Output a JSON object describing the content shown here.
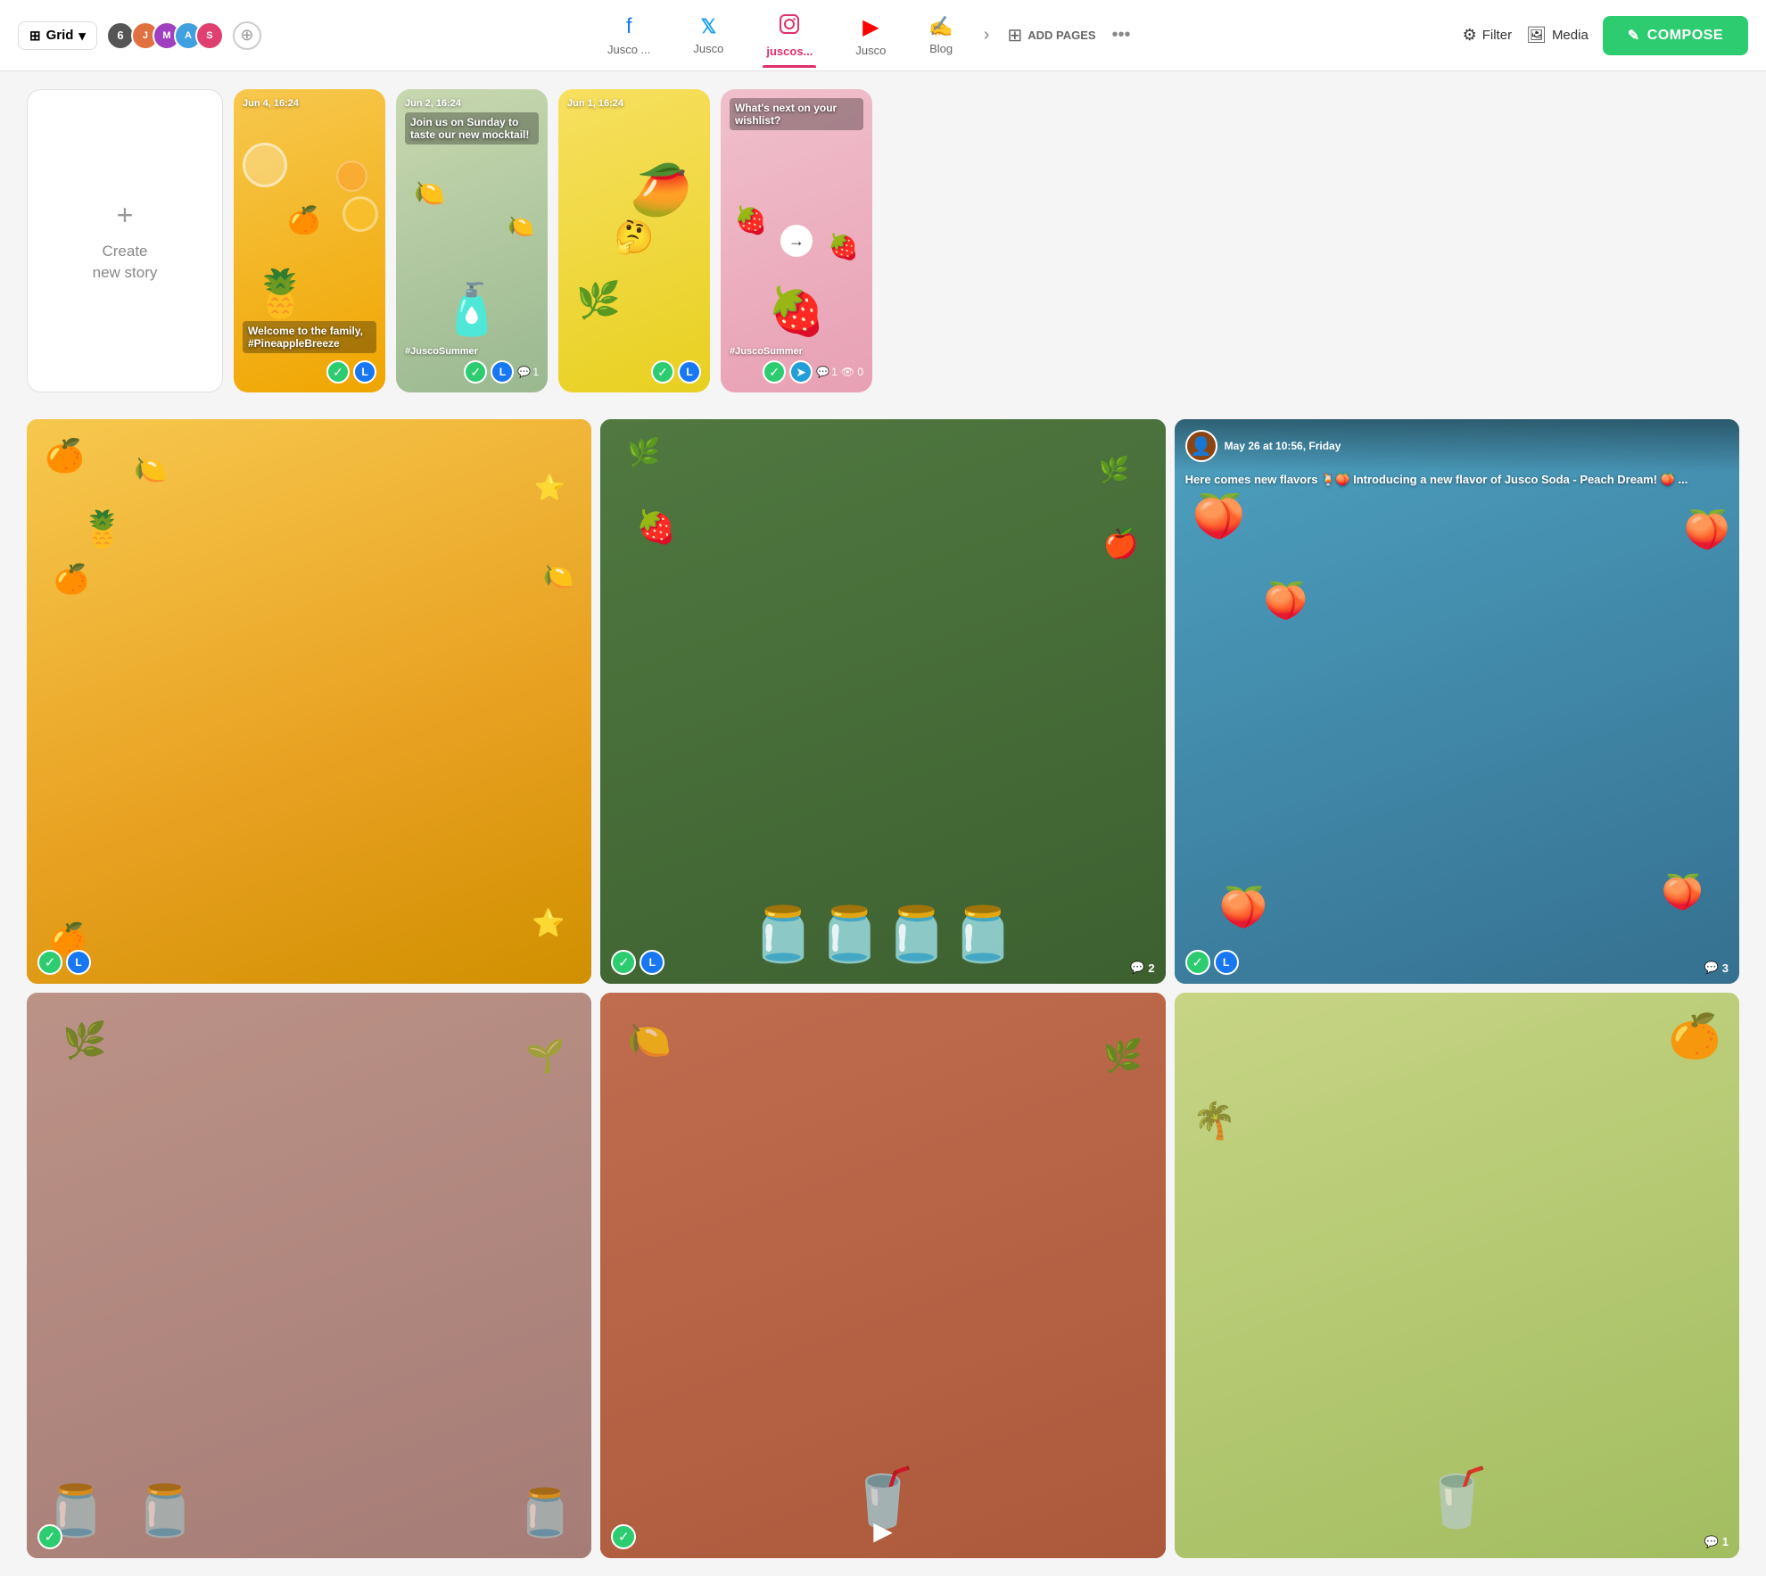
{
  "topnav": {
    "grid_label": "Grid",
    "avatar_count": "6",
    "tabs": [
      {
        "id": "facebook",
        "label": "Jusco ...",
        "icon": "f",
        "active": false,
        "color": "#1877f2"
      },
      {
        "id": "twitter",
        "label": "Jusco",
        "icon": "𝕏",
        "active": false,
        "color": "#1da1f2"
      },
      {
        "id": "instagram",
        "label": "juscos...",
        "icon": "📸",
        "active": true,
        "color": "#e1306c"
      },
      {
        "id": "youtube",
        "label": "Jusco",
        "icon": "▶",
        "active": false,
        "color": "#ff0000"
      },
      {
        "id": "blog",
        "label": "Blog",
        "icon": "✍",
        "active": false,
        "color": "#666"
      }
    ],
    "add_pages_label": "ADD PAGES",
    "filter_label": "Filter",
    "media_label": "Media",
    "compose_label": "COMPOSE"
  },
  "stories": {
    "create_plus": "+",
    "create_label": "Create\nnew story",
    "cards": [
      {
        "id": "s1",
        "timestamp": "Jun 4, 16:24",
        "text": "Welcome to the family, #PineappleBreeze",
        "hashtag": "",
        "has_check": true,
        "has_avatar": true,
        "has_comment": false,
        "comment_count": ""
      },
      {
        "id": "s2",
        "timestamp": "Jun 2, 16:24",
        "text": "Join us on Sunday to taste our new mocktail!",
        "hashtag": "#JuscoSummer",
        "has_check": true,
        "has_avatar": true,
        "has_comment": true,
        "comment_count": "1"
      },
      {
        "id": "s3",
        "timestamp": "Jun 1, 16:24",
        "text": "",
        "hashtag": "",
        "emoji": "🤔",
        "has_check": true,
        "has_avatar": true,
        "has_comment": false,
        "comment_count": ""
      },
      {
        "id": "s4",
        "timestamp": "",
        "text": "What's next on your wishlist?",
        "hashtag": "#JuscoSummer",
        "has_check": true,
        "has_tg": true,
        "has_comment": true,
        "comment_count": "1",
        "has_arrow": true
      }
    ]
  },
  "posts": {
    "row1": [
      {
        "id": "p1",
        "bg_class": "pb1",
        "has_check": true,
        "has_avatar": true,
        "has_comment": false,
        "comment_count": "",
        "is_facebook": false
      },
      {
        "id": "p2",
        "bg_class": "pb2",
        "has_check": true,
        "has_avatar": true,
        "has_comment": true,
        "comment_count": "2",
        "is_facebook": false
      },
      {
        "id": "p3",
        "bg_class": "pb3",
        "has_check": true,
        "has_avatar": true,
        "has_comment": true,
        "comment_count": "3",
        "is_facebook": true,
        "fb_date": "May 26 at 10:56, Friday",
        "fb_text": "Here comes new flavors 🍹🍑 Introducing a new flavor of Jusco Soda - Peach Dream! 🍑 ..."
      }
    ],
    "row2": [
      {
        "id": "p4",
        "bg_class": "pb4",
        "has_check": true,
        "has_avatar": false,
        "has_comment": false,
        "comment_count": "",
        "is_video": false,
        "is_facebook": false
      },
      {
        "id": "p5",
        "bg_class": "pb5",
        "has_check": true,
        "has_avatar": false,
        "has_comment": false,
        "comment_count": "",
        "is_video": true,
        "is_facebook": false
      },
      {
        "id": "p6",
        "bg_class": "pb6",
        "has_check": false,
        "has_avatar": false,
        "has_comment": true,
        "comment_count": "1",
        "is_video": false,
        "is_facebook": false
      }
    ]
  }
}
